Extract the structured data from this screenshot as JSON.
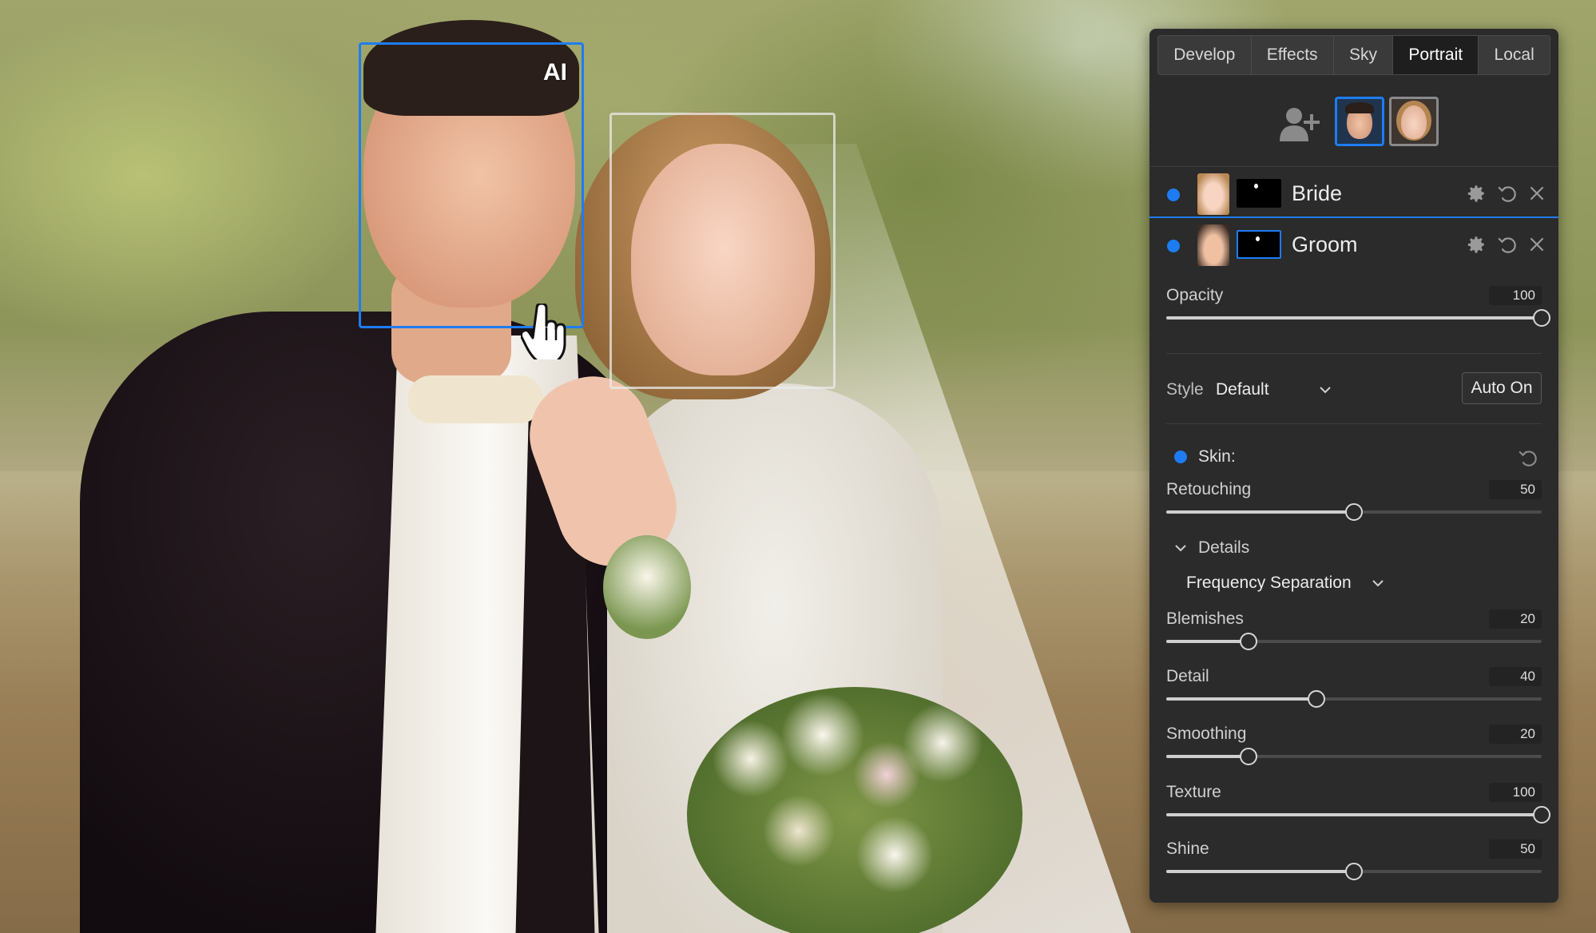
{
  "canvas": {
    "ai_badge": "AI"
  },
  "panel": {
    "tabs": [
      {
        "label": "Develop",
        "active": false
      },
      {
        "label": "Effects",
        "active": false
      },
      {
        "label": "Sky",
        "active": false
      },
      {
        "label": "Portrait",
        "active": true
      },
      {
        "label": "Local",
        "active": false
      }
    ],
    "masks": [
      {
        "name": "Bride"
      },
      {
        "name": "Groom"
      }
    ],
    "opacity": {
      "label": "Opacity",
      "value": "100",
      "fraction": 1.0
    },
    "style": {
      "label": "Style",
      "value": "Default",
      "auto_button": "Auto On"
    },
    "skin": {
      "label": "Skin:"
    },
    "retouching": {
      "label": "Retouching",
      "value": "50",
      "fraction": 0.5
    },
    "details": {
      "label": "Details",
      "mode": "Frequency Separation"
    },
    "sliders": [
      {
        "label": "Blemishes",
        "value": "20",
        "fraction": 0.22
      },
      {
        "label": "Detail",
        "value": "40",
        "fraction": 0.4
      },
      {
        "label": "Smoothing",
        "value": "20",
        "fraction": 0.22
      },
      {
        "label": "Texture",
        "value": "100",
        "fraction": 1.0
      },
      {
        "label": "Shine",
        "value": "50",
        "fraction": 0.5
      }
    ]
  },
  "colors": {
    "accent": "#1e7cf2",
    "panel_bg": "#2b2b2b"
  }
}
